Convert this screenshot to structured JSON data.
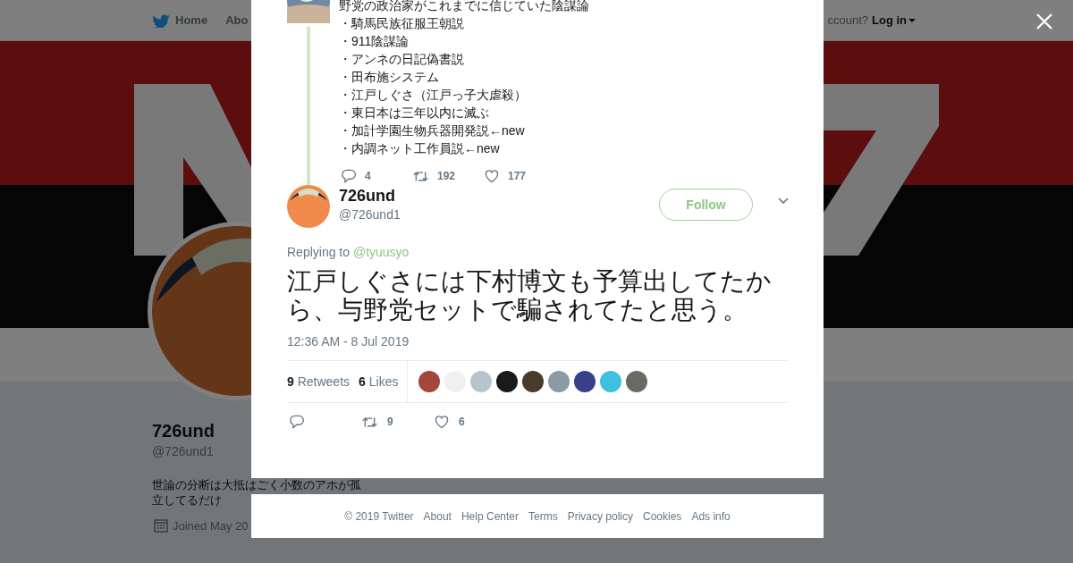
{
  "nav": {
    "items": [
      {
        "label": "Home"
      },
      {
        "label": "Abo"
      }
    ],
    "login_prompt": "ccount?",
    "login": "Log in"
  },
  "profile": {
    "name": "726und",
    "handle": "@726und1",
    "bio": "世論の分断は大抵はごく小数のアホが孤立してるだけ",
    "joined": "Joined May 20"
  },
  "thread": {
    "previous_tweet": {
      "lines": [
        "野党の政治家がこれまでに信じていた陰謀論",
        "・騎馬民族征服王朝説",
        "・911陰謀論",
        "・アンネの日記偽書説",
        "・田布施システム",
        "・江戸しぐさ（江戸っ子大虐殺）",
        "・東日本は三年以内に滅ぶ",
        "・加計学園生物兵器開発説←new",
        "・内調ネット工作員説←new"
      ],
      "actions": {
        "replies": "4",
        "retweets": "192",
        "likes": "177"
      }
    },
    "tweet": {
      "name": "726und",
      "handle": "@726und1",
      "follow": "Follow",
      "replying_label": "Replying to",
      "replying_to": "@tyuusyo",
      "text": "江戸しぐさには下村博文も予算出してたから、与野党セットで騙されてたと思う。",
      "time": "12:36 AM - 8 Jul 2019",
      "stats": [
        "**9** Retweets",
        "**6** Likes"
      ],
      "likers": [
        {
          "color": "#a3463c"
        },
        {
          "color": "#f0f0f0"
        },
        {
          "color": "#b8c4cc"
        },
        {
          "color": "#1a1a1a"
        },
        {
          "color": "#4a3a2c"
        },
        {
          "color": "#8a9aa6"
        },
        {
          "color": "#3a3f8a"
        },
        {
          "color": "#3ec0e0"
        },
        {
          "color": "#6a6a62"
        }
      ],
      "actions": {
        "retweets": "9",
        "likes": "6"
      }
    }
  },
  "footer": {
    "links": [
      "© 2019 Twitter",
      "About",
      "Help Center",
      "Terms",
      "Privacy policy",
      "Cookies",
      "Ads info"
    ]
  }
}
